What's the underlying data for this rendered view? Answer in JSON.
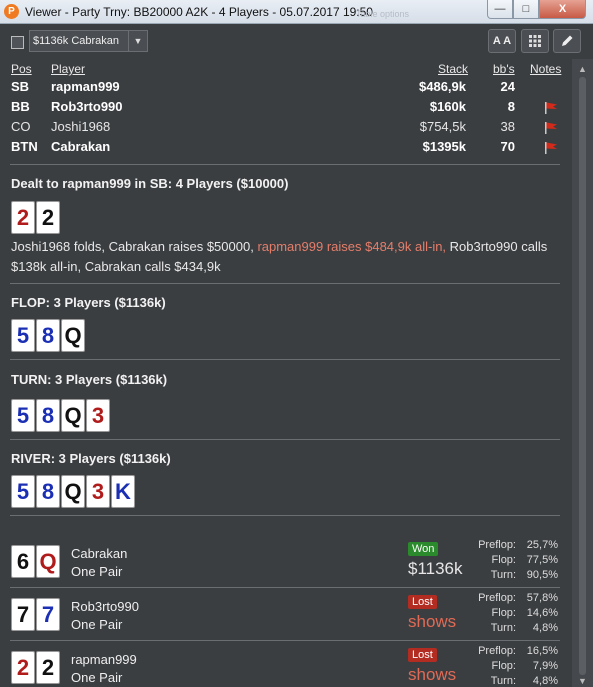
{
  "window": {
    "app_icon": "party-poker-icon",
    "title": "Viewer - Party Trny: BB20000 A2K - 4 Players - 05.07.2017 19:50",
    "background_text": "Table options",
    "min_label": "—",
    "max_label": "□",
    "close_label": "X"
  },
  "toolbar": {
    "hand_select_value": "$1136k Cabrakan",
    "font_button": "A A",
    "grid_icon": "grid-icon",
    "edit_icon": "pencil-icon"
  },
  "players": {
    "headers": {
      "pos": "Pos",
      "player": "Player",
      "stack": "Stack",
      "bbs": "bb's",
      "notes": "Notes"
    },
    "rows": [
      {
        "pos": "SB",
        "name": "rapman999",
        "stack": "$486,9k",
        "bbs": "24",
        "bold": true,
        "flag": false
      },
      {
        "pos": "BB",
        "name": "Rob3rto990",
        "stack": "$160k",
        "bbs": "8",
        "bold": true,
        "flag": true
      },
      {
        "pos": "CO",
        "name": "Joshi1968",
        "stack": "$754,5k",
        "bbs": "38",
        "bold": false,
        "flag": true
      },
      {
        "pos": "BTN",
        "name": "Cabrakan",
        "stack": "$1395k",
        "bbs": "70",
        "bold": true,
        "flag": true
      }
    ],
    "flag_color": "#d22a1b"
  },
  "preflop": {
    "title": "Dealt to rapman999 in SB: 4 Players ($10000)",
    "hole_cards": [
      {
        "rank": "2",
        "color": "red"
      },
      {
        "rank": "2",
        "color": "black"
      }
    ],
    "action_part1": "Joshi1968 folds, Cabrakan raises $50000, ",
    "action_highlight": "rapman999 raises $484,9k all-in,",
    "action_part2": " Rob3rto990 calls $138k all-in, Cabrakan calls $434,9k"
  },
  "flop": {
    "title": "FLOP: 3 Players ($1136k)",
    "cards": [
      {
        "rank": "5",
        "color": "blue"
      },
      {
        "rank": "8",
        "color": "blue"
      },
      {
        "rank": "Q",
        "color": "black"
      }
    ]
  },
  "turn": {
    "title": "TURN: 3 Players ($1136k)",
    "cards": [
      {
        "rank": "5",
        "color": "blue"
      },
      {
        "rank": "8",
        "color": "blue"
      },
      {
        "rank": "Q",
        "color": "black"
      },
      {
        "rank": "3",
        "color": "red"
      }
    ]
  },
  "river": {
    "title": "RIVER: 3 Players ($1136k)",
    "cards": [
      {
        "rank": "5",
        "color": "blue"
      },
      {
        "rank": "8",
        "color": "blue"
      },
      {
        "rank": "Q",
        "color": "black"
      },
      {
        "rank": "3",
        "color": "red"
      },
      {
        "rank": "K",
        "color": "blue"
      }
    ]
  },
  "results": [
    {
      "name": "Cabrakan",
      "hand": "One Pair",
      "cards": [
        {
          "rank": "6",
          "color": "black"
        },
        {
          "rank": "Q",
          "color": "red"
        }
      ],
      "badge": "Won",
      "amount": "$1136k",
      "stats": [
        {
          "label": "Preflop:",
          "value": "25,7%"
        },
        {
          "label": "Flop:",
          "value": "77,5%"
        },
        {
          "label": "Turn:",
          "value": "90,5%"
        }
      ]
    },
    {
      "name": "Rob3rto990",
      "hand": "One Pair",
      "cards": [
        {
          "rank": "7",
          "color": "black"
        },
        {
          "rank": "7",
          "color": "blue"
        }
      ],
      "badge": "Lost",
      "amount": "shows",
      "stats": [
        {
          "label": "Preflop:",
          "value": "57,8%"
        },
        {
          "label": "Flop:",
          "value": "14,6%"
        },
        {
          "label": "Turn:",
          "value": "4,8%"
        }
      ]
    },
    {
      "name": "rapman999",
      "hand": "One Pair",
      "cards": [
        {
          "rank": "2",
          "color": "red"
        },
        {
          "rank": "2",
          "color": "black"
        }
      ],
      "badge": "Lost",
      "amount": "shows",
      "stats": [
        {
          "label": "Preflop:",
          "value": "16,5%"
        },
        {
          "label": "Flop:",
          "value": "7,9%"
        },
        {
          "label": "Turn:",
          "value": "4,8%"
        }
      ]
    }
  ],
  "colors": {
    "won": "#2b8a2b",
    "lost": "#b22c22",
    "highlight": "#e57d6a",
    "card_red": "#b01b1b",
    "card_blue": "#1b2fb5"
  }
}
